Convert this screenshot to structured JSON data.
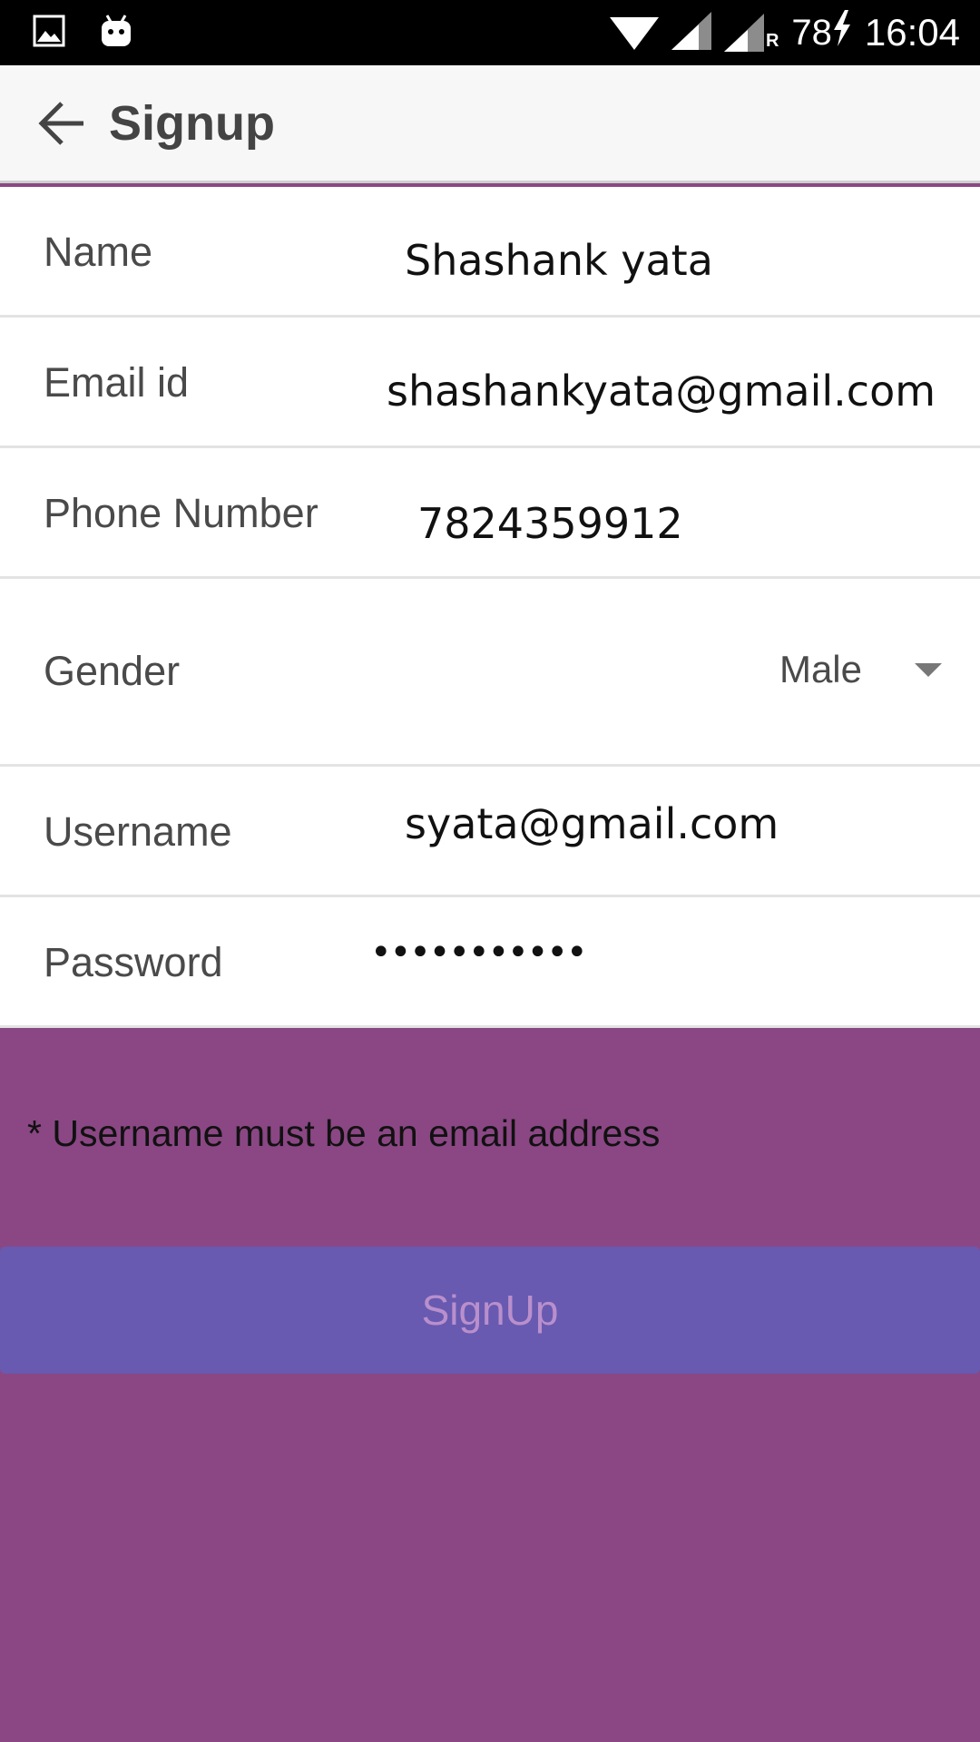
{
  "status_bar": {
    "time": "16:04",
    "battery_level": "78",
    "roaming_indicator": "R",
    "icons": [
      "image-notification-icon",
      "android-robot-icon",
      "wifi-icon",
      "cell-signal-icon",
      "cell-signal-roaming-icon",
      "battery-charging-icon"
    ]
  },
  "toolbar": {
    "title": "Signup",
    "back_icon": "arrow-left-icon"
  },
  "form": {
    "name": {
      "label": "Name",
      "value": "Shashank yata"
    },
    "email": {
      "label": "Email id",
      "value": "shashankyata@gmail.com"
    },
    "phone": {
      "label": "Phone Number",
      "value": "7824359912"
    },
    "gender": {
      "label": "Gender",
      "selected": "Male"
    },
    "username": {
      "label": "Username",
      "value": "syata@gmail.com"
    },
    "password": {
      "label": "Password",
      "value": "•••••••••••"
    }
  },
  "note": "* Username must be an email address",
  "signup_button": {
    "label": "SignUp"
  },
  "colors": {
    "background": "#8a4784",
    "button": "#685ab1",
    "button_text": "#b98fcc",
    "toolbar": "#f7f7f7",
    "status_bar": "#000000"
  }
}
